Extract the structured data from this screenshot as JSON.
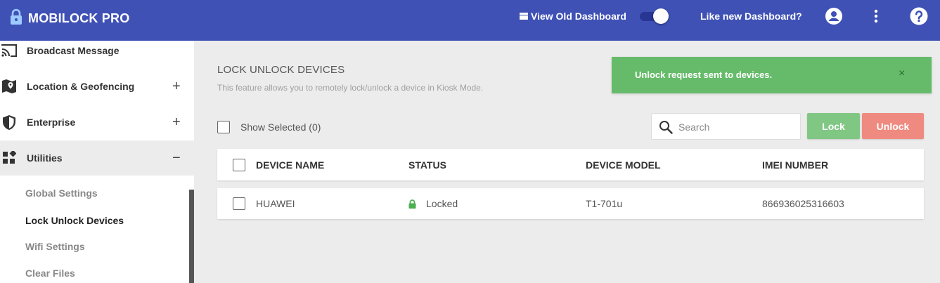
{
  "app": {
    "title": "MOBILOCK PRO",
    "view_old_dashboard": "View Old Dashboard",
    "like_new_dashboard": "Like new Dashboard?",
    "dashboard_toggle_on": true,
    "brand_color": "#3f51b5"
  },
  "sidebar": {
    "items": [
      {
        "label": "Broadcast Message",
        "icon": "cast-icon",
        "sign": ""
      },
      {
        "label": "Location & Geofencing",
        "icon": "map-pin-icon",
        "sign": "+"
      },
      {
        "label": "Enterprise",
        "icon": "shield-icon",
        "sign": "+"
      },
      {
        "label": "Utilities",
        "icon": "widgets-icon",
        "sign": "−"
      }
    ],
    "subitems": [
      {
        "label": "Global Settings",
        "selected": false
      },
      {
        "label": "Lock Unlock Devices",
        "selected": true
      },
      {
        "label": "Wifi Settings",
        "selected": false
      },
      {
        "label": "Clear Files",
        "selected": false
      }
    ]
  },
  "main": {
    "title": "LOCK UNLOCK DEVICES",
    "subtitle": "This feature allows you to remotely lock/unlock a device in Kiosk Mode.",
    "show_selected_label": "Show Selected (0)",
    "search_placeholder": "Search",
    "lock_button": "Lock",
    "unlock_button": "Unlock",
    "toast": {
      "message": "Unlock request sent to devices.",
      "close": "×",
      "color": "#66bb6a"
    },
    "table": {
      "columns": [
        "DEVICE NAME",
        "STATUS",
        "DEVICE MODEL",
        "IMEI NUMBER"
      ],
      "rows": [
        {
          "device_name": "HUAWEI",
          "status": "Locked",
          "device_model": "T1-701u",
          "imei": "866936025316603"
        }
      ]
    }
  }
}
